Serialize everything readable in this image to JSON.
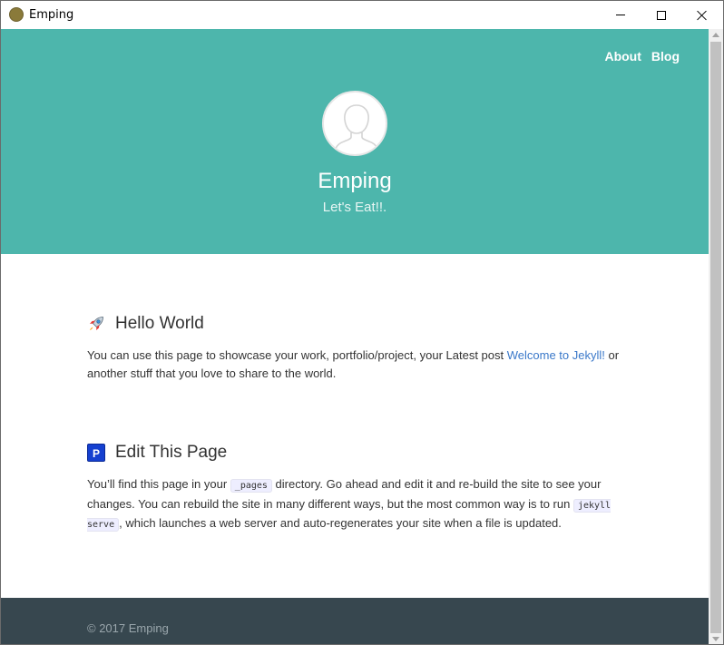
{
  "window": {
    "title": "Emping"
  },
  "header": {
    "nav": [
      {
        "label": "About"
      },
      {
        "label": "Blog"
      }
    ],
    "site_title": "Emping",
    "tagline": "Let's Eat!!."
  },
  "sections": [
    {
      "heading": "Hello World",
      "icon": "rocket-icon",
      "text_before_link": "You can use this page to showcase your work, portfolio/project, your Latest post ",
      "link_text": "Welcome to Jekyll!",
      "text_after_link": " or another stuff that you love to share to the world."
    },
    {
      "heading": "Edit This Page",
      "icon": "p-letter-icon",
      "icon_letter": "P",
      "text_1": "You’ll find this page in your ",
      "code_1": "_pages",
      "text_2": " directory. Go ahead and edit it and re-build the site to see your changes. You can rebuild the site in many different ways, but the most common way is to run ",
      "code_2": "jekyll serve",
      "text_3": ", which launches a web server and auto-regenerates your site when a file is updated."
    }
  ],
  "footer": {
    "copyright": "© 2017 Emping"
  },
  "colors": {
    "header_bg": "#4db6ac",
    "footer_bg": "#37474f",
    "link": "#3a78c9"
  }
}
